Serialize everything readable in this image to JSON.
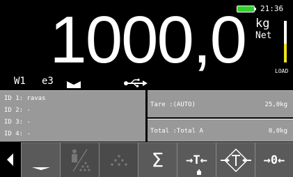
{
  "status_bar": {
    "time": "21:36",
    "battery_color": "#2ed12e",
    "battery_icon": "battery-full-icon"
  },
  "display": {
    "weight": "1000,0",
    "unit": "kg",
    "mode": "Net",
    "load_label": "LOAD",
    "load_fraction": 0.45,
    "load_color": "#f2e51a",
    "indicators": {
      "w": "W1",
      "e": "e3",
      "icons": [
        "bowtie-icon",
        "usb-icon"
      ]
    }
  },
  "id_panel": {
    "lines": [
      "ID 1: ravas",
      "ID 2: -",
      "ID 3: -",
      "ID 4: -"
    ]
  },
  "tare": {
    "label": "Tare  :(AUTO)",
    "value": "25,0kg"
  },
  "total": {
    "label": "Total :Total A",
    "value": "0,0kg"
  },
  "softkeys": [
    {
      "icon": "left-arrow-icon"
    },
    {
      "icon": "dropdown-key-icon"
    },
    {
      "icon": "piece-count-icon"
    },
    {
      "icon": "dots-triangle-icon"
    },
    {
      "icon": "sum-icon",
      "text": "Σ"
    },
    {
      "icon": "tare-key-icon",
      "text": "→T←"
    },
    {
      "icon": "preset-tare-icon"
    },
    {
      "icon": "zero-key-icon",
      "text": "→0←"
    }
  ],
  "colors": {
    "panel_bg": "#999999",
    "key_bg": "#5a5a5a"
  }
}
